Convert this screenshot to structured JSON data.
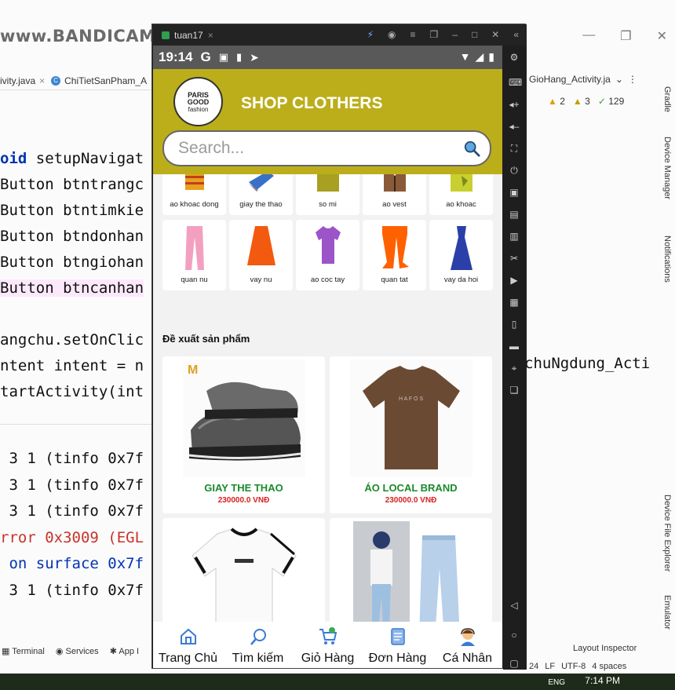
{
  "ide": {
    "watermark": "www.BANDICAM.com",
    "tabs": [
      "ivity.java",
      "ChiTietSanPham_A"
    ],
    "right_tab": "GioHang_Activity.ja",
    "warnings": [
      "2",
      "3",
      "129"
    ],
    "code_lines": [
      {
        "kw": "oid",
        "rest": " setupNavigat"
      },
      {
        "kw": "",
        "rest": "Button btntrangc"
      },
      {
        "kw": "",
        "rest": "Button btntimkie"
      },
      {
        "kw": "",
        "rest": "Button btndonhan"
      },
      {
        "kw": "",
        "rest": "Button btngiohan"
      },
      {
        "kw": "",
        "rest": "Button btncanhan"
      },
      {
        "kw": "",
        "rest": ""
      },
      {
        "kw": "",
        "rest": "angchu.setOnClic"
      },
      {
        "kw": "",
        "rest": "ntent intent = n"
      },
      {
        "kw": "",
        "rest": "tartActivity(int"
      }
    ],
    "right_code": "chuNgdung_Acti",
    "log_lines": [
      {
        "cls": "",
        "text": " 3 1 (tinfo 0x7f"
      },
      {
        "cls": "",
        "text": " 3 1 (tinfo 0x7f"
      },
      {
        "cls": "",
        "text": " 3 1 (tinfo 0x7f"
      },
      {
        "cls": "err",
        "text": "rror 0x3009 (EGL"
      },
      {
        "cls": "blue",
        "text": " on surface 0x7f"
      },
      {
        "cls": "",
        "text": " 3 1 (tinfo 0x7f"
      }
    ],
    "bottom_tabs": [
      "Terminal",
      "Services",
      "App I"
    ],
    "sidebar_labels": [
      "Gradle",
      "Device Manager",
      "Notifications",
      "Device File Explorer",
      "Emulator"
    ],
    "layout_inspector": "Layout Inspector",
    "status": [
      "24",
      "LF",
      "UTF-8",
      "4 spaces"
    ],
    "taskbar_time": "7:14 PM",
    "taskbar_lang": "ENG"
  },
  "emulator": {
    "title": "tuan17",
    "status_time": "19:14",
    "status_icons": [
      "G"
    ]
  },
  "app": {
    "shop_title": "SHOP CLOTHERS",
    "logo_line1": "PARIS",
    "logo_line2": "GOOD",
    "logo_line3": "fashion",
    "search_placeholder": "Search...",
    "categories_row1": [
      {
        "label": "ao khoac dong",
        "icon": "winter-jacket",
        "color": "#e8a020"
      },
      {
        "label": "giay the thao",
        "icon": "sneaker",
        "color": "#3a70c8"
      },
      {
        "label": "so mi",
        "icon": "shirt",
        "color": "#a8a020"
      },
      {
        "label": "ao vest",
        "icon": "vest",
        "color": "#8b5a3a"
      },
      {
        "label": "ao khoac",
        "icon": "jacket",
        "color": "#c8d030"
      }
    ],
    "categories_row2": [
      {
        "label": "quan nu",
        "icon": "pants",
        "color": "#f3a0c0"
      },
      {
        "label": "vay nu",
        "icon": "skirt",
        "color": "#f25a10"
      },
      {
        "label": "ao coc tay",
        "icon": "tshirt",
        "color": "#9b55c8"
      },
      {
        "label": "quan tat",
        "icon": "tights",
        "color": "#ff6000"
      },
      {
        "label": "vay da hoi",
        "icon": "dress",
        "color": "#2a40a8"
      }
    ],
    "recommend_heading": "Đề xuất sản phẩm",
    "products": [
      {
        "name": "GIAY THE THAO",
        "price": "230000.0 VNĐ",
        "image": "sneaker-photo"
      },
      {
        "name": "ÁO LOCAL BRAND",
        "price": "230000.0 VNĐ",
        "image": "brown-tshirt-photo"
      },
      {
        "name": "",
        "price": "",
        "image": "white-tshirt-photo"
      },
      {
        "name": "",
        "price": "",
        "image": "jeans-photo"
      }
    ],
    "bottom_nav": [
      {
        "label": "Trang Chủ",
        "icon": "home-icon"
      },
      {
        "label": "Tìm kiếm",
        "icon": "search-nav-icon"
      },
      {
        "label": "Giỏ Hàng",
        "icon": "cart-icon"
      },
      {
        "label": "Đơn Hàng",
        "icon": "orders-icon"
      },
      {
        "label": "Cá Nhân",
        "icon": "profile-icon"
      }
    ],
    "colors": {
      "header": "#bcae1b",
      "product_name": "#1a8a2c",
      "price": "#d82020"
    }
  }
}
